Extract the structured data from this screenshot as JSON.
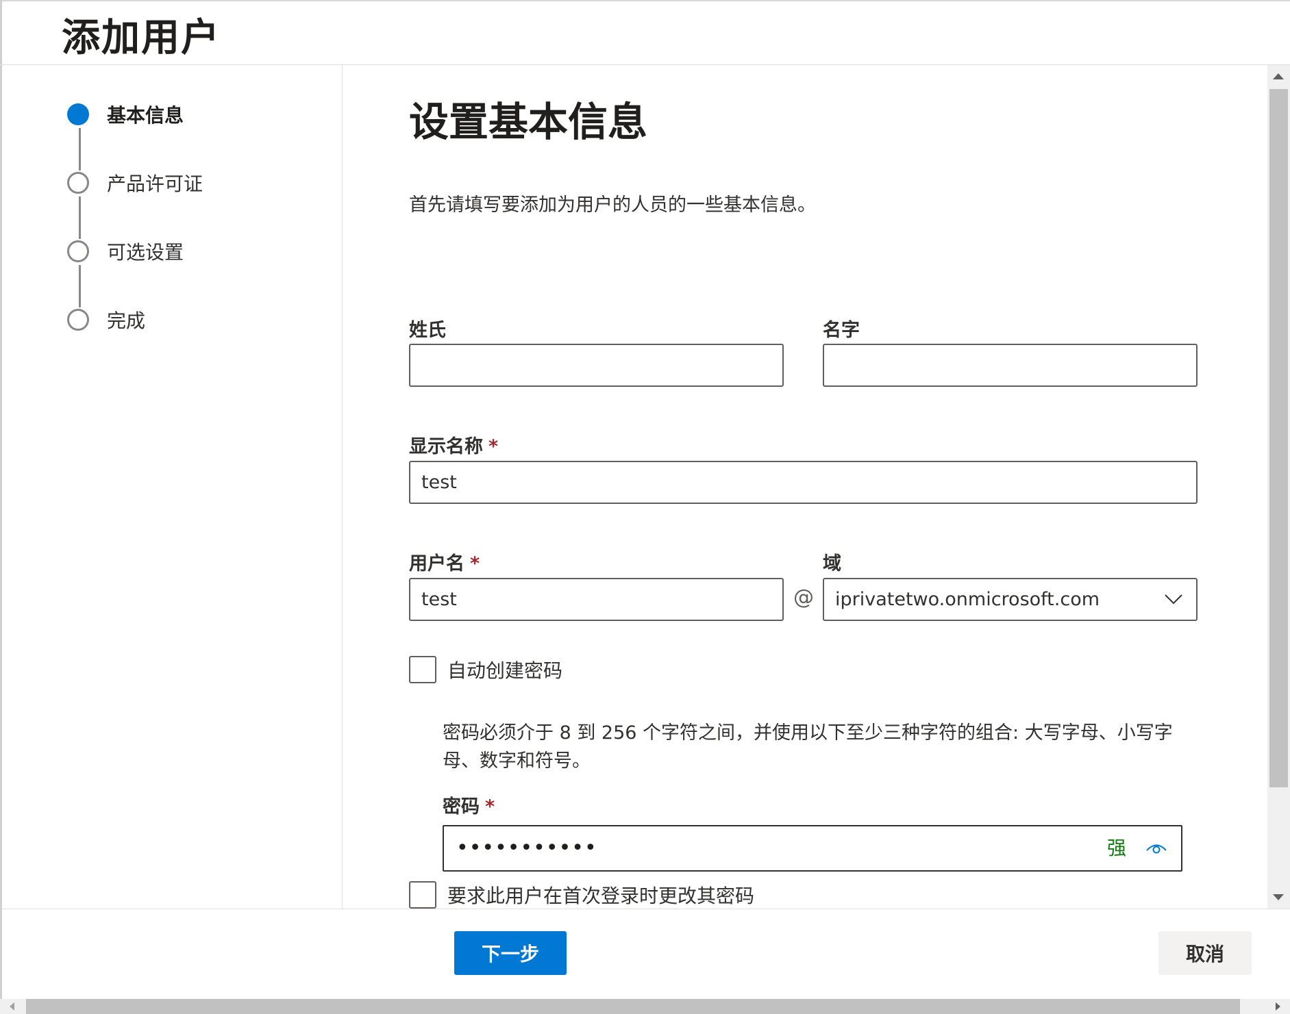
{
  "header": {
    "title": "添加用户"
  },
  "steps": [
    {
      "label": "基本信息",
      "state": "active"
    },
    {
      "label": "产品许可证",
      "state": "pending"
    },
    {
      "label": "可选设置",
      "state": "pending"
    },
    {
      "label": "完成",
      "state": "pending"
    }
  ],
  "main": {
    "title": "设置基本信息",
    "description": "首先请填写要添加为用户的人员的一些基本信息。"
  },
  "form": {
    "last_name": {
      "label": "姓氏",
      "value": ""
    },
    "first_name": {
      "label": "名字",
      "value": ""
    },
    "display_name": {
      "label": "显示名称",
      "required_mark": "*",
      "value": "test"
    },
    "username": {
      "label": "用户名",
      "required_mark": "*",
      "value": "test"
    },
    "at_symbol": "@",
    "domain": {
      "label": "域",
      "value": "iprivatetwo.onmicrosoft.com"
    },
    "auto_password": {
      "label": "自动创建密码",
      "checked": false
    },
    "password_hint": "密码必须介于 8 到 256 个字符之间，并使用以下至少三种字符的组合: 大写字母、小写字母、数字和符号。",
    "password": {
      "label": "密码",
      "required_mark": "*",
      "masked_value": "•••••••••••",
      "strength": "强"
    },
    "require_change": {
      "label": "要求此用户在首次登录时更改其密码",
      "checked": false
    }
  },
  "footer": {
    "next_label": "下一步",
    "cancel_label": "取消"
  },
  "colors": {
    "accent": "#0078d4",
    "required": "#a4262c",
    "strength_strong": "#107c10"
  },
  "icons": {
    "domain_dropdown": "chevron-down-icon",
    "password_reveal": "eye-icon"
  }
}
